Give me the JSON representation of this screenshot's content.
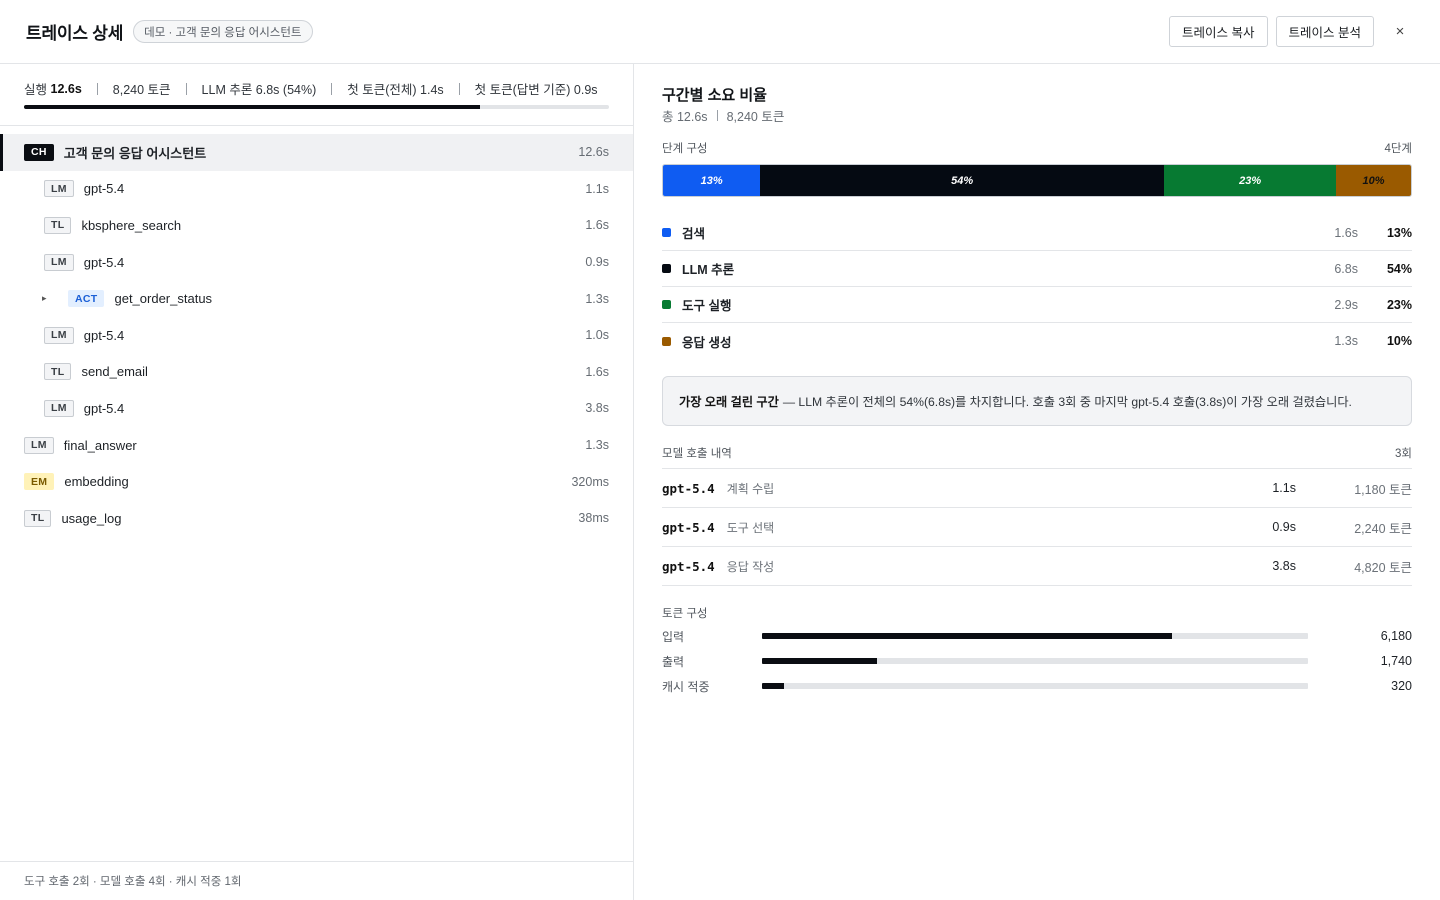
{
  "header": {
    "title": "트레이스 상세",
    "pill": "데모 · 고객 문의 응답 어시스턴트",
    "copy_button": "트레이스 복사",
    "analyze_button": "트레이스 분석",
    "close_icon": "×"
  },
  "summary": {
    "run_label": "실행",
    "run_value": "12.6s",
    "tokens": "8,240 토큰",
    "llm": "LLM 추론 6.8s (54%)",
    "first_token_all": "첫 토큰(전체) 1.4s",
    "first_token_answer": "첫 토큰(답변 기준) 0.9s",
    "progress": 0.78
  },
  "tree": [
    {
      "badge": "CH",
      "kind": "ch",
      "label": "고객 문의 응답 어시스턴트",
      "duration": "12.6s",
      "depth": 0,
      "active": true
    },
    {
      "badge": "LM",
      "kind": "lm",
      "label": "gpt-5.4",
      "duration": "1.1s",
      "depth": 1
    },
    {
      "badge": "TL",
      "kind": "tl",
      "label": "kbsphere_search",
      "duration": "1.6s",
      "depth": 1
    },
    {
      "badge": "LM",
      "kind": "lm",
      "label": "gpt-5.4",
      "duration": "0.9s",
      "depth": 1
    },
    {
      "badge": "ACT",
      "kind": "act",
      "label": "get_order_status",
      "duration": "1.3s",
      "depth": 2,
      "caret": "▸"
    },
    {
      "badge": "LM",
      "kind": "lm",
      "label": "gpt-5.4",
      "duration": "1.0s",
      "depth": 1
    },
    {
      "badge": "TL",
      "kind": "tl",
      "label": "send_email",
      "duration": "1.6s",
      "depth": 1
    },
    {
      "badge": "LM",
      "kind": "lm",
      "label": "gpt-5.4",
      "duration": "3.8s",
      "depth": 1
    },
    {
      "badge": "LM",
      "kind": "lm",
      "label": "final_answer",
      "duration": "1.3s",
      "depth": 0
    },
    {
      "badge": "EM",
      "kind": "em",
      "label": "embedding",
      "duration": "320ms",
      "depth": 0
    },
    {
      "badge": "TL",
      "kind": "tl",
      "label": "usage_log",
      "duration": "38ms",
      "depth": 0
    }
  ],
  "footer": "도구 호출 2회 · 모델 호출 4회 · 캐시 적중 1회",
  "breakdown": {
    "title": "구간별 소요 비율",
    "total": "총 12.6s",
    "total_tokens": "8,240 토큰",
    "stage_label": "단계 구성",
    "stage_count": "4단계",
    "phases": [
      {
        "name": "검색",
        "time": "1.6s",
        "pct": "13%",
        "share": 0.13,
        "color": "#0f5cf2",
        "text": "#ffffff"
      },
      {
        "name": "LLM 추론",
        "time": "6.8s",
        "pct": "54%",
        "share": 0.54,
        "color": "#050a12",
        "text": "#ffffff"
      },
      {
        "name": "도구 실행",
        "time": "2.9s",
        "pct": "23%",
        "share": 0.23,
        "color": "#077a32",
        "text": "#ffffff"
      },
      {
        "name": "응답 생성",
        "time": "1.3s",
        "pct": "10%",
        "share": 0.1,
        "color": "#9a5a00",
        "text": "#111111"
      }
    ],
    "callout_title": "가장 오래 걸린 구간",
    "callout_text": "— LLM 추론이 전체의 54%(6.8s)를 차지합니다. 호출 3회 중 마지막 gpt-5.4 호출(3.8s)이 가장 오래 걸렸습니다.",
    "calls_label": "모델 호출 내역",
    "calls_count": "3회",
    "calls": [
      {
        "model": "gpt-5.4",
        "desc": "계획 수립",
        "time": "1.1s",
        "tokens": "1,180 토큰"
      },
      {
        "model": "gpt-5.4",
        "desc": "도구 선택",
        "time": "0.9s",
        "tokens": "2,240 토큰"
      },
      {
        "model": "gpt-5.4",
        "desc": "응답 작성",
        "time": "3.8s",
        "tokens": "4,820 토큰"
      }
    ],
    "tokens_label": "토큰 구성",
    "tokens": [
      {
        "label": "입력",
        "value": "6,180",
        "share": 0.75
      },
      {
        "label": "출력",
        "value": "1,740",
        "share": 0.21
      },
      {
        "label": "캐시 적중",
        "value": "320",
        "share": 0.04
      }
    ]
  }
}
